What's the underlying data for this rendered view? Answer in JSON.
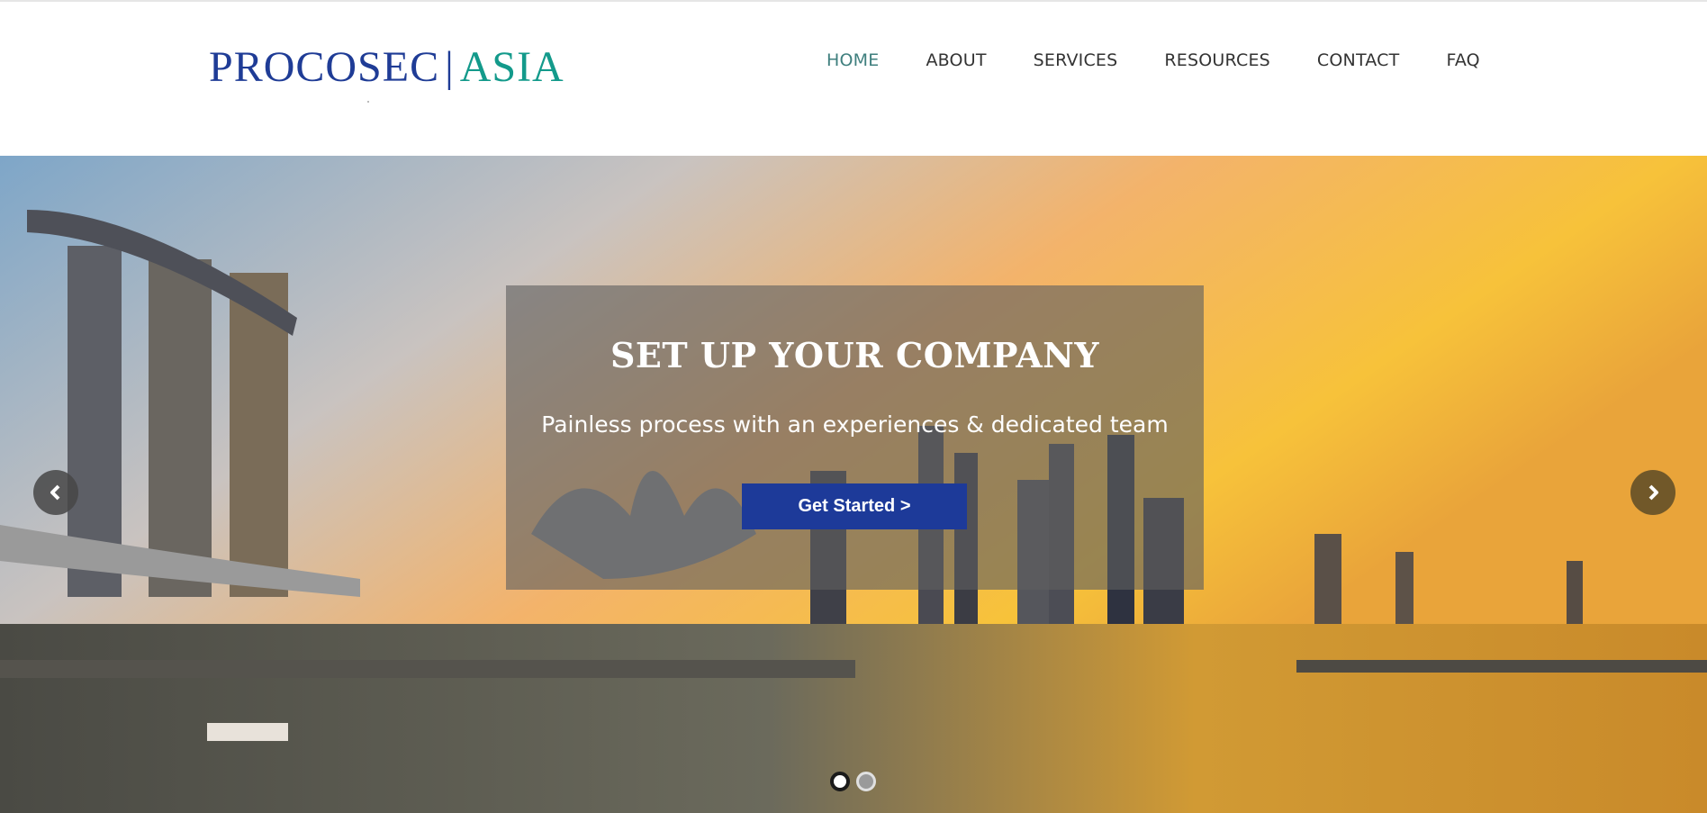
{
  "logo": {
    "part1": "PROCOSEC",
    "divider": "|",
    "part2": "ASIA"
  },
  "nav": {
    "items": [
      {
        "label": "HOME",
        "active": true
      },
      {
        "label": "ABOUT"
      },
      {
        "label": "SERVICES"
      },
      {
        "label": "RESOURCES"
      },
      {
        "label": "CONTACT"
      },
      {
        "label": "FAQ"
      }
    ]
  },
  "hero": {
    "title": "SET UP YOUR COMPANY",
    "subtitle": "Painless process with an experiences & dedicated team",
    "cta_label": "Get Started >",
    "prev_icon": "chevron-left-icon",
    "next_icon": "chevron-right-icon",
    "slides": 2,
    "active_slide": 1
  },
  "colors": {
    "brand_blue": "#1f3c96",
    "brand_teal": "#139a8b",
    "nav_active": "#3f7f7e",
    "cta_bg": "#1d3a99"
  }
}
